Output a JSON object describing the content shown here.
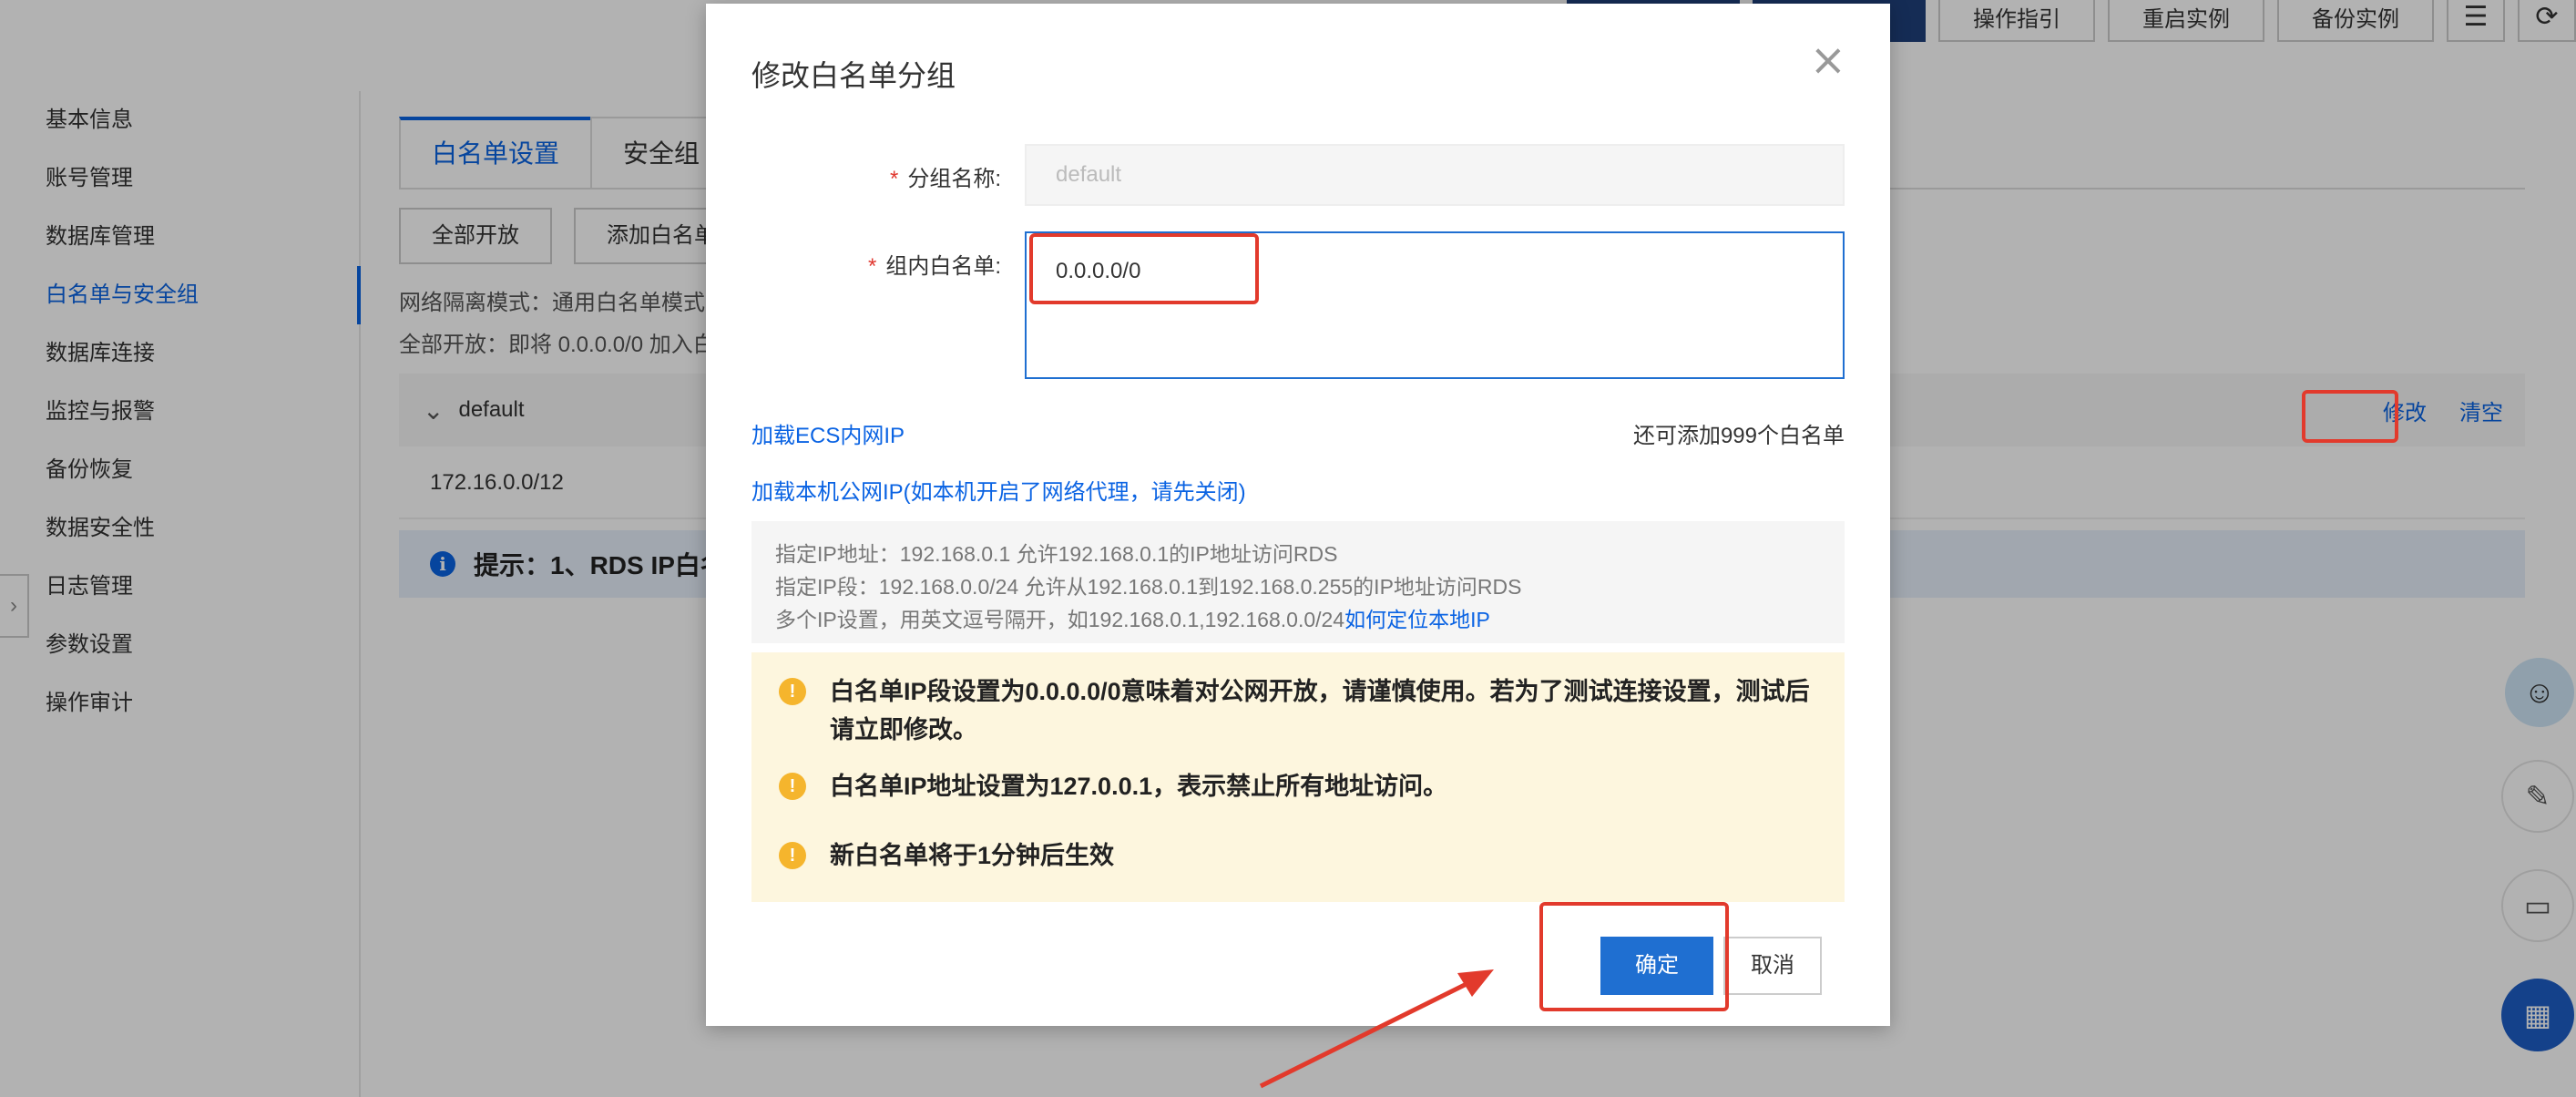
{
  "header": {
    "actions": [
      "操作指引",
      "重启实例",
      "备份实例"
    ]
  },
  "sidebar": {
    "items": [
      {
        "label": "基本信息"
      },
      {
        "label": "账号管理"
      },
      {
        "label": "数据库管理"
      },
      {
        "label": "白名单与安全组",
        "active": true
      },
      {
        "label": "数据库连接"
      },
      {
        "label": "监控与报警"
      },
      {
        "label": "备份恢复"
      },
      {
        "label": "数据安全性"
      },
      {
        "label": "日志管理"
      },
      {
        "label": "参数设置"
      },
      {
        "label": "操作审计"
      }
    ]
  },
  "content": {
    "tabs": [
      "白名单设置",
      "安全组"
    ],
    "buttons": [
      "全部开放",
      "添加白名单"
    ],
    "isolation_mode": "网络隔离模式：通用白名单模式",
    "open_all_note": "全部开放：即将 0.0.0.0/0 加入白",
    "group_name": "default",
    "row_actions": {
      "edit": "修改",
      "clear": "清空"
    },
    "ip_entry": "172.16.0.0/12",
    "tip": "提示：1、RDS IP白名"
  },
  "dialog": {
    "title": "修改白名单分组",
    "close_icon": "×",
    "group_name_label": "分组名称:",
    "group_name_value": "default",
    "whitelist_label": "组内白名单:",
    "whitelist_value": "0.0.0.0/0",
    "load_ecs": "加载ECS内网IP",
    "remaining": "还可添加999个白名单",
    "load_local": "加载本机公网IP(如本机开启了网络代理，请先关闭)",
    "hints": [
      "指定IP地址：192.168.0.1 允许192.168.0.1的IP地址访问RDS",
      "指定IP段：192.168.0.0/24 允许从192.168.0.1到192.168.0.255的IP地址访问RDS",
      "多个IP设置，用英文逗号隔开，如192.168.0.1,192.168.0.0/24"
    ],
    "hint_link": "如何定位本地IP",
    "warnings": [
      "白名单IP段设置为0.0.0.0/0意味着对公网开放，请谨慎使用。若为了测试连接设置，测试后请立即修改。",
      "白名单IP地址设置为127.0.0.1，表示禁止所有地址访问。",
      "新白名单将于1分钟后生效"
    ],
    "ok": "确定",
    "cancel": "取消"
  },
  "colors": {
    "primary": "#1f6fd1",
    "link": "#0a63e3",
    "annotation": "#e23a2c",
    "warning_bg": "#fdf6de",
    "warning_icon": "#f5b52d"
  }
}
